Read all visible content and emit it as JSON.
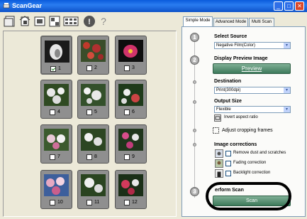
{
  "window": {
    "title": "ScanGear"
  },
  "toolbar": {
    "icons": [
      "preview-icon",
      "crop-icon",
      "single-frame-icon",
      "single-frame-alt-icon",
      "multi-frame-icon",
      "info-icon",
      "help-icon"
    ]
  },
  "frames": [
    {
      "number": "1",
      "checked": true
    },
    {
      "number": "2",
      "checked": false
    },
    {
      "number": "3",
      "checked": false
    },
    {
      "number": "4",
      "checked": false
    },
    {
      "number": "5",
      "checked": false
    },
    {
      "number": "6",
      "checked": false
    },
    {
      "number": "7",
      "checked": false
    },
    {
      "number": "8",
      "checked": false
    },
    {
      "number": "9",
      "checked": false
    },
    {
      "number": "10",
      "checked": false
    },
    {
      "number": "11",
      "checked": false
    },
    {
      "number": "12",
      "checked": false
    }
  ],
  "tabs": [
    {
      "label": "Simple Mode",
      "active": true
    },
    {
      "label": "Advanced Mode",
      "active": false
    },
    {
      "label": "Multi Scan",
      "active": false
    }
  ],
  "steps": {
    "step1": "1",
    "step2": "2",
    "step3": "3",
    "select_source": {
      "label": "Select Source",
      "value": "Negative Film(Color)"
    },
    "display_preview": {
      "label": "Display Preview Image",
      "button": "Preview"
    },
    "destination": {
      "label": "Destination",
      "value": "Print(300dpi)"
    },
    "output_size": {
      "label": "Output Size",
      "value": "Flexible",
      "invert_label": "Invert aspect ratio"
    },
    "adjust_crop": {
      "label": "Adjust cropping frames"
    },
    "image_corrections": {
      "label": "Image corrections",
      "options": [
        "Remove dust and scratches",
        "Fading correction",
        "Backlight correction"
      ]
    },
    "perform_scan": {
      "label": "erform Scan",
      "button": "Scan"
    }
  }
}
